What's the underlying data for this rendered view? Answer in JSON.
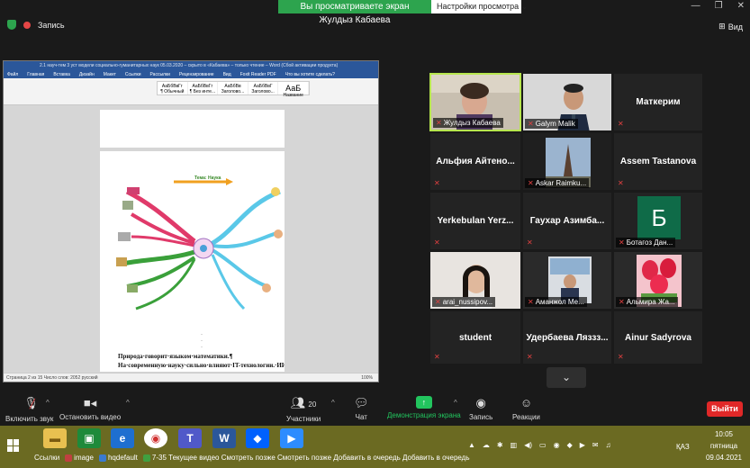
{
  "banner": {
    "viewing_text": "Вы просматриваете экран Жулдыз Кабаева",
    "view_options": "Настройки просмотра"
  },
  "window_controls": {
    "minimize": "—",
    "restore": "❐",
    "close": "✕"
  },
  "recording": {
    "label": "Запись"
  },
  "view_button": {
    "label": "Вид"
  },
  "shared_doc": {
    "title_bar": "2.1 науч-тем 3 уст модели социально-гуманитарных наук 05.03.2020 – скрыто в «Кабаева» – только чтение – Word (Сбой активации продукта)",
    "tabs": [
      "Файл",
      "Главная",
      "Вставка",
      "Дизайн",
      "Макет",
      "Ссылки",
      "Рассылки",
      "Рецензирование",
      "Вид",
      "Foxit Reader PDF",
      "Что вы хотите сделать?"
    ],
    "styles": [
      "АаБбВвГг",
      "АаБбВвГг",
      "АаБбВв",
      "АаБбВвГ",
      "АаБ"
    ],
    "style_names": [
      "¶ Обычный",
      "¶ Без инте...",
      "Заголово...",
      "Заголово...",
      "Название"
    ],
    "mindmap_topic": "Тема: Наука",
    "text_line_1": "Природа·говорит·языком·математики.¶",
    "text_line_2": "На·современную·науку·сильно·влияют·IT-технологии.·ИИ·",
    "status_left": "Страница 2 из 15   Число слов: 2052   русский",
    "status_right": "100%"
  },
  "participants": [
    {
      "name": "Жулдыз Кабаева",
      "type": "video",
      "active": true
    },
    {
      "name": "Galym Malik",
      "type": "video",
      "active": false
    },
    {
      "name": "Маткерим",
      "type": "text",
      "active": false
    },
    {
      "name": "Альфия  Айтено...",
      "type": "text",
      "active": false
    },
    {
      "name": "Askar Raimku...",
      "type": "video",
      "active": false
    },
    {
      "name": "Assem Tastanova",
      "type": "text",
      "active": false
    },
    {
      "name": "Yerkebulan  Yerz...",
      "type": "text",
      "active": false
    },
    {
      "name": "Гаухар  Азимба...",
      "type": "text",
      "active": false
    },
    {
      "name": "Ботагоз Дан...",
      "type": "avatar",
      "avatar_letter": "Б",
      "active": false
    },
    {
      "name": "arai_nussipov...",
      "type": "video",
      "active": false
    },
    {
      "name": "Аманжол Ме...",
      "type": "video",
      "active": false
    },
    {
      "name": "Альмира Жа...",
      "type": "video",
      "active": false
    },
    {
      "name": "student",
      "type": "text",
      "active": false
    },
    {
      "name": "Удербаева  Ляззз...",
      "type": "text",
      "active": false
    },
    {
      "name": "Ainur Sadyrova",
      "type": "text",
      "active": false
    }
  ],
  "toolbar": {
    "unmute": "Включить звук",
    "stop_video": "Остановить видео",
    "participants": "Участники",
    "participants_count": "20",
    "chat": "Чат",
    "share_screen": "Демонстрация экрана",
    "record": "Запись",
    "reactions": "Реакции",
    "leave": "Выйти"
  },
  "taskbar": {
    "links_label": "Ссылки",
    "link_items": [
      "image",
      "hqdefault",
      "7-35 Текущее видео Смотреть позже Смотреть позже Добавить в очередь Добавить в очередь"
    ],
    "lang": "ҚАЗ",
    "time": "10:05",
    "day": "пятница",
    "date": "09.04.2021"
  },
  "colors": {
    "zoom_green": "#2da44e",
    "active_speaker": "#b7e64e",
    "leave_red": "#e02828",
    "word_blue": "#2b579a",
    "taskbar": "#6b6a22"
  }
}
